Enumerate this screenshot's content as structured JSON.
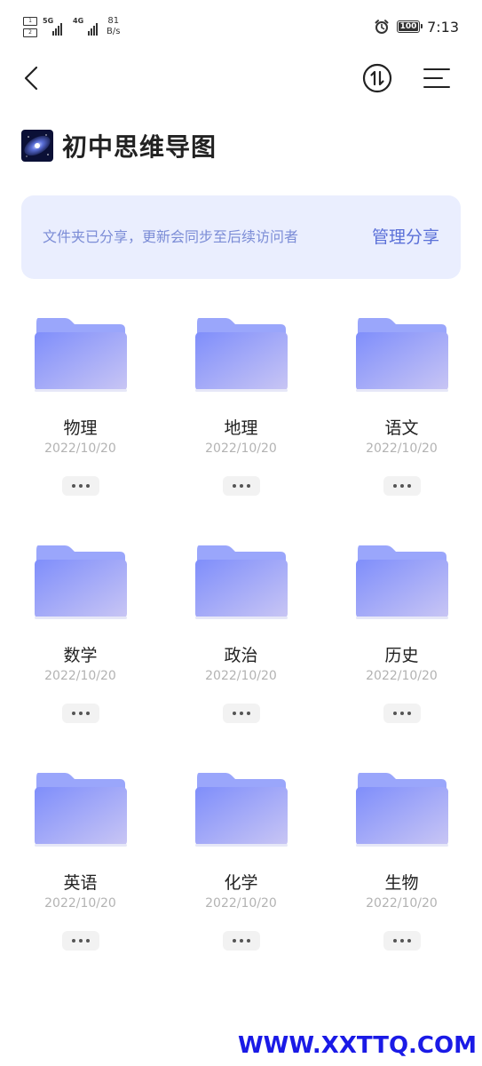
{
  "status_bar": {
    "sim1_label": "1",
    "sim2_label": "2",
    "net1_label": "5G",
    "net2_label": "4G",
    "speed_value": "81",
    "speed_unit": "B/s",
    "battery_level": "100",
    "time": "7:13",
    "icons": [
      "sim-card-icon",
      "signal-icon",
      "alarm-icon",
      "battery-icon"
    ]
  },
  "toolbar": {
    "icons": [
      "back-arrow-icon",
      "sort-icon",
      "menu-icon"
    ]
  },
  "header": {
    "title": "初中思维导图",
    "thumb_icon": "galaxy-thumbnail"
  },
  "share_banner": {
    "message": "文件夹已分享，更新会同步至后续访问者",
    "action_label": "管理分享"
  },
  "folders": [
    {
      "name": "物理",
      "date": "2022/10/20"
    },
    {
      "name": "地理",
      "date": "2022/10/20"
    },
    {
      "name": "语文",
      "date": "2022/10/20"
    },
    {
      "name": "数学",
      "date": "2022/10/20"
    },
    {
      "name": "政治",
      "date": "2022/10/20"
    },
    {
      "name": "历史",
      "date": "2022/10/20"
    },
    {
      "name": "英语",
      "date": "2022/10/20"
    },
    {
      "name": "化学",
      "date": "2022/10/20"
    },
    {
      "name": "生物",
      "date": "2022/10/20"
    }
  ],
  "watermark": "WWW.XXTTQ.COM",
  "colors": {
    "banner_bg": "#eaeefe",
    "banner_text": "#7b8cd6",
    "banner_action": "#5b70d8",
    "folder_back": "#9aa6fb",
    "folder_front_start": "#7f8efb",
    "folder_front_end": "#c9c6f4",
    "watermark": "#1a1ae6"
  }
}
